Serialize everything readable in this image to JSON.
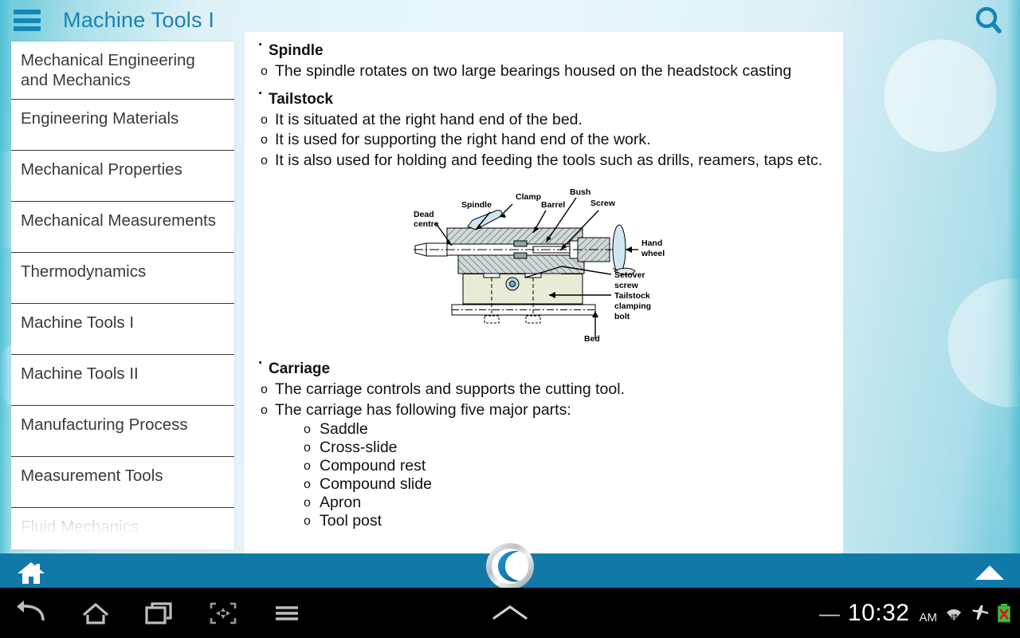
{
  "header": {
    "title": "Machine Tools I",
    "menu_icon": "hamburger-menu-icon",
    "search_icon": "search-icon",
    "accent_color": "#1a82b6"
  },
  "sidebar": {
    "items": [
      {
        "label": "Mechanical Engineering and Mechanics",
        "faded": false
      },
      {
        "label": "Engineering Materials",
        "faded": false
      },
      {
        "label": "Mechanical Properties",
        "faded": false
      },
      {
        "label": "Mechanical Measurements",
        "faded": false
      },
      {
        "label": "Thermodynamics",
        "faded": false
      },
      {
        "label": "Machine Tools I",
        "faded": false
      },
      {
        "label": "Machine Tools II",
        "faded": false
      },
      {
        "label": "Manufacturing Process",
        "faded": false
      },
      {
        "label": "Measurement Tools",
        "faded": false
      },
      {
        "label": "Fluid Mechanics",
        "faded": true
      }
    ]
  },
  "content": {
    "sections": [
      {
        "heading": "Spindle",
        "bullets": [
          "The spindle rotates on two large bearings housed on the headstock casting"
        ],
        "subbullets": []
      },
      {
        "heading": "Tailstock",
        "bullets": [
          "It is situated at the right hand end of the bed.",
          "It is used for supporting the right hand end of the work.",
          "It is also used for holding and feeding the tools such as drills, reamers, taps etc."
        ],
        "subbullets": []
      },
      {
        "heading": "Carriage",
        "bullets": [
          "The carriage controls and supports the cutting tool.",
          "The carriage has following five major parts:"
        ],
        "subbullets": [
          "Saddle",
          "Cross-slide",
          "Compound rest",
          "Compound slide",
          "Apron",
          "Tool post"
        ]
      }
    ],
    "figure": {
      "name": "tailstock-diagram",
      "labels": [
        "Dead centre",
        "Spindle",
        "Clamp",
        "Barrel",
        "Bush",
        "Screw",
        "Hand wheel",
        "Setover screw",
        "Tailstock clamping bolt",
        "Bed"
      ]
    }
  },
  "appbar": {
    "home_icon": "home-icon",
    "logo_icon": "app-logo-icon",
    "collapse_icon": "up-arrow-icon",
    "bar_color": "#1179a8"
  },
  "navbar": {
    "buttons": [
      "back-icon",
      "home-icon",
      "recents-icon",
      "screenshot-icon",
      "menu-icon"
    ],
    "center_icon": "chevron-up-icon",
    "status": {
      "dash": "—",
      "time": "10:32",
      "meridiem": "AM",
      "icons": [
        "wifi-icon",
        "airplane-mode-icon",
        "battery-error-icon"
      ]
    }
  }
}
